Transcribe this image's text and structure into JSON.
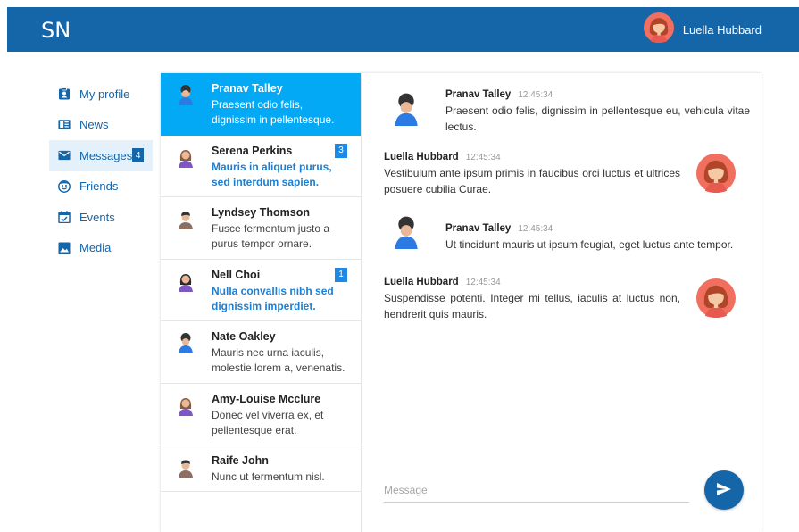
{
  "app": {
    "brand": "SN"
  },
  "header": {
    "user_name": "Luella Hubbard"
  },
  "colors": {
    "primary": "#1565a9",
    "active_conversation": "#03a9f4",
    "unread_text": "#1e7fd2"
  },
  "sidebar": {
    "items": [
      {
        "label": "My profile",
        "icon": "profile-badge-icon"
      },
      {
        "label": "News",
        "icon": "newspaper-icon"
      },
      {
        "label": "Messages",
        "icon": "envelope-icon",
        "badge": "4",
        "active": true
      },
      {
        "label": "Friends",
        "icon": "smiley-face-icon"
      },
      {
        "label": "Events",
        "icon": "calendar-check-icon"
      },
      {
        "label": "Media",
        "icon": "image-icon"
      }
    ]
  },
  "conversations": [
    {
      "name": "Pranav Talley",
      "preview": "Praesent odio felis, dignissim in pellentesque."
    },
    {
      "name": "Serena Perkins",
      "preview": "Mauris in aliquet purus, sed interdum sapien.",
      "badge": "3"
    },
    {
      "name": "Lyndsey Thomson",
      "preview": "Fusce fermentum justo a purus tempor ornare."
    },
    {
      "name": "Nell Choi",
      "preview": "Nulla convallis nibh sed dignissim imperdiet.",
      "badge": "1"
    },
    {
      "name": "Nate Oakley",
      "preview": "Mauris nec urna iaculis, molestie lorem a, venenatis."
    },
    {
      "name": "Amy-Louise Mcclure",
      "preview": "Donec vel viverra ex, et pellentesque erat."
    },
    {
      "name": "Raife John",
      "preview": "Nunc ut fermentum nisl."
    }
  ],
  "messages": [
    {
      "sender": "Pranav Talley",
      "time": "12:45:34",
      "text": "Praesent odio felis, dignissim in pellentesque eu, vehicula vitae lectus."
    },
    {
      "sender": "Luella Hubbard",
      "time": "12:45:34",
      "text": "Vestibulum ante ipsum primis in faucibus orci luctus et ultrices posuere cubilia Curae."
    },
    {
      "sender": "Pranav Talley",
      "time": "12:45:34",
      "text": "Ut tincidunt mauris ut ipsum feugiat, eget luctus ante tempor."
    },
    {
      "sender": "Luella Hubbard",
      "time": "12:45:34",
      "text": "Suspendisse potenti. Integer mi tellus, iaculis at luctus non, hendrerit quis mauris."
    }
  ],
  "composer": {
    "placeholder": "Message",
    "value": ""
  }
}
